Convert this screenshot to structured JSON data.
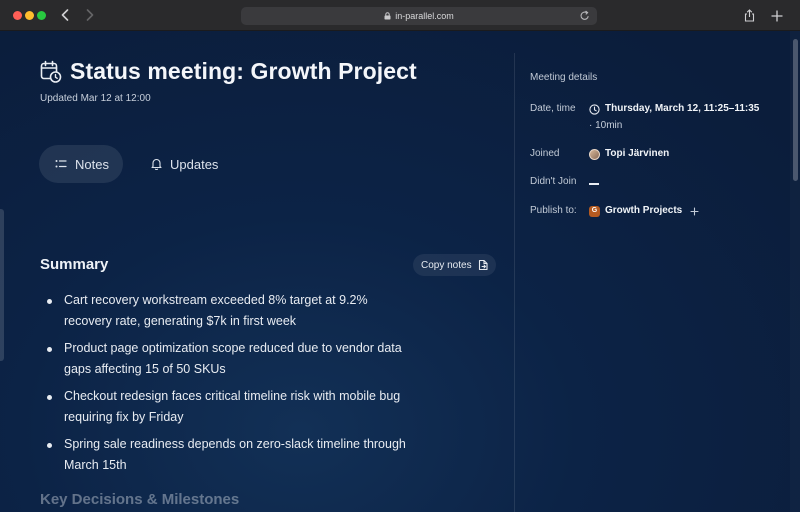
{
  "browser": {
    "url": "in-parallel.com"
  },
  "meeting": {
    "title": "Status meeting: Growth Project",
    "updated": "Updated Mar 12 at 12:00"
  },
  "tabs": [
    {
      "label": "Notes",
      "active": true,
      "icon": "list-icon"
    },
    {
      "label": "Updates",
      "active": false,
      "icon": "bell-icon"
    }
  ],
  "summary": {
    "heading": "Summary",
    "copy_label": "Copy notes",
    "bullets": [
      "Cart recovery workstream exceeded 8% target at 9.2% recovery rate, generating $7k in first week",
      "Product page optimization scope reduced due to vendor data gaps affecting 15 of 50 SKUs",
      "Checkout redesign faces critical timeline risk with mobile bug requiring fix by Friday",
      "Spring sale readiness depends on zero-slack timeline through March 15th"
    ]
  },
  "next_section": {
    "heading": "Key Decisions & Milestones"
  },
  "details": {
    "heading": "Meeting details",
    "date_label": "Date, time",
    "date_value": "Thursday, March 12, 11:25–11:35",
    "duration": "· 10min",
    "joined_label": "Joined",
    "joined_person": "Topi Järvinen",
    "didnt_join_label": "Didn't Join",
    "publish_label": "Publish to:",
    "publish_badge": "G",
    "publish_target": "Growth Projects"
  },
  "colors": {
    "background": "#0c2346",
    "text": "#e8ecf2",
    "project_badge": "#b55a20"
  }
}
